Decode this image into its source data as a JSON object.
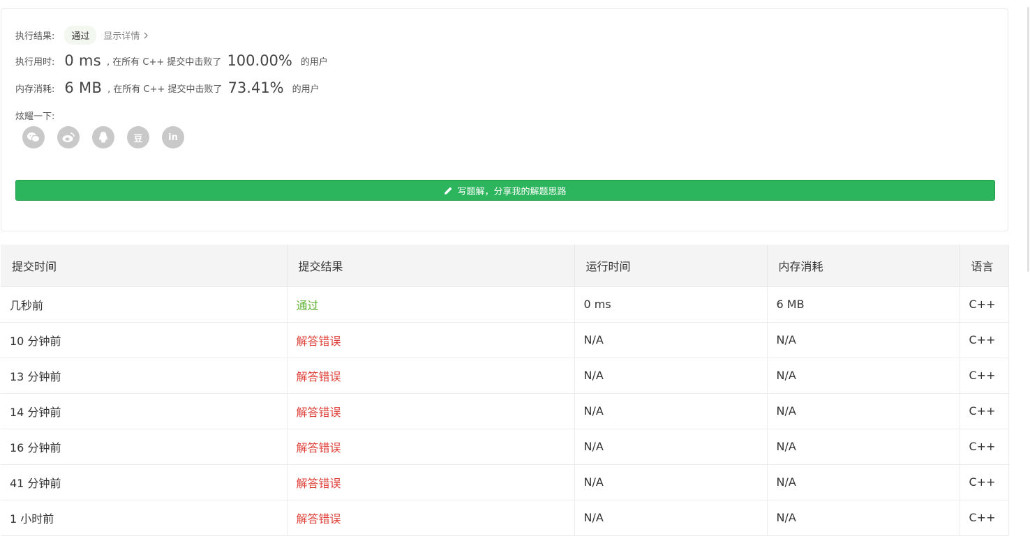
{
  "result": {
    "status_label": "执行结果:",
    "status_badge": "通过",
    "detail_link": "显示详情",
    "runtime_label": "执行用时:",
    "runtime_value": "0 ms",
    "runtime_desc": ", 在所有 C++ 提交中击败了",
    "runtime_pct": "100.00%",
    "runtime_suffix": "的用户",
    "memory_label": "内存消耗:",
    "memory_value": "6 MB",
    "memory_desc": ", 在所有 C++ 提交中击败了",
    "memory_pct": "73.41%",
    "memory_suffix": "的用户",
    "share_label": "炫耀一下:",
    "share_icons": [
      "wechat-icon",
      "weibo-icon",
      "qq-icon",
      "douban-icon",
      "linkedin-icon"
    ],
    "douban_glyph": "豆",
    "linkedin_glyph": "in",
    "write_button": "写题解，分享我的解题思路"
  },
  "colors": {
    "accent_green": "#2db55d",
    "pass_text": "#5cb130",
    "error_text": "#e0433b"
  },
  "submissions": {
    "headers": [
      "提交时间",
      "提交结果",
      "运行时间",
      "内存消耗",
      "语言"
    ],
    "rows": [
      {
        "time": "几秒前",
        "result": "通过",
        "runtime": "0 ms",
        "memory": "6 MB",
        "lang": "C++"
      },
      {
        "time": "10 分钟前",
        "result": "解答错误",
        "runtime": "N/A",
        "memory": "N/A",
        "lang": "C++"
      },
      {
        "time": "13 分钟前",
        "result": "解答错误",
        "runtime": "N/A",
        "memory": "N/A",
        "lang": "C++"
      },
      {
        "time": "14 分钟前",
        "result": "解答错误",
        "runtime": "N/A",
        "memory": "N/A",
        "lang": "C++"
      },
      {
        "time": "16 分钟前",
        "result": "解答错误",
        "runtime": "N/A",
        "memory": "N/A",
        "lang": "C++"
      },
      {
        "time": "41 分钟前",
        "result": "解答错误",
        "runtime": "N/A",
        "memory": "N/A",
        "lang": "C++"
      },
      {
        "time": "1 小时前",
        "result": "解答错误",
        "runtime": "N/A",
        "memory": "N/A",
        "lang": "C++"
      }
    ]
  }
}
